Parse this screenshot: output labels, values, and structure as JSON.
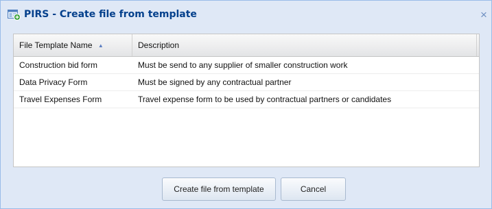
{
  "window": {
    "title": "PIRS - Create file from template",
    "title_icon": "template-file-add-icon",
    "close_icon": "close-icon",
    "close_glyph": "×"
  },
  "grid": {
    "columns": [
      {
        "label": "File Template Name",
        "sort": "ascending"
      },
      {
        "label": "Description"
      }
    ],
    "sort_glyph": "▲",
    "rows": [
      {
        "name": "Construction bid form",
        "description": "Must be send to any supplier of smaller construction work"
      },
      {
        "name": "Data Privacy Form",
        "description": "Must be signed by any contractual partner"
      },
      {
        "name": "Travel Expenses Form",
        "description": "Travel expense form to be used by contractual partners or candidates"
      }
    ]
  },
  "buttons": {
    "create_label": "Create file from template",
    "cancel_label": "Cancel"
  },
  "colors": {
    "title_text": "#04408c",
    "dialog_background": "#dfe8f6",
    "border": "#99bce8"
  }
}
